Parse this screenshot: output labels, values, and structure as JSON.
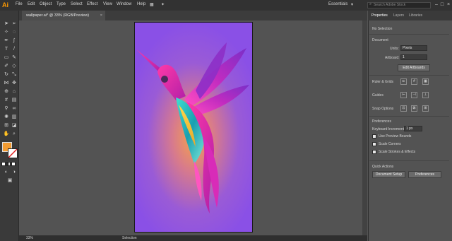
{
  "app": {
    "logo": "Ai"
  },
  "menu": [
    "File",
    "Edit",
    "Object",
    "Type",
    "Select",
    "Effect",
    "View",
    "Window",
    "Help"
  ],
  "workspace": {
    "label": "Essentials",
    "search_placeholder": "Search Adobe Stock"
  },
  "document": {
    "tab_label": "wallpaper.ai* @ 33% (RGB/Preview)",
    "close": "×"
  },
  "status": {
    "zoom": "33%",
    "tool": "Selection"
  },
  "panel": {
    "tabs": [
      "Properties",
      "Layers",
      "Libraries"
    ],
    "selection": "No Selection",
    "document_heading": "Document",
    "units_label": "Units:",
    "units_value": "Pixels",
    "artboard_label": "Artboard:",
    "artboard_value": "1",
    "edit_artboards": "Edit Artboards",
    "rulers_heading": "Ruler & Grids",
    "guides_heading": "Guides",
    "snap_heading": "Snap Options",
    "preferences_heading": "Preferences",
    "keyboard_increment_label": "Keyboard Increment:",
    "keyboard_increment_value": "1 px",
    "options": [
      "Use Preview Bounds",
      "Scale Corners",
      "Scale Strokes & Effects"
    ],
    "quick_actions_heading": "Quick Actions",
    "document_setup": "Document Setup",
    "preferences_button": "Preferences"
  },
  "colors": {
    "fill": "#f39c32",
    "artboard_purple": "#8a50e6",
    "accent": "#ff9a00"
  },
  "icons": [
    "selection-tool-icon",
    "direct-selection-tool-icon",
    "pen-tool-icon",
    "type-tool-icon",
    "rectangle-tool-icon",
    "brush-tool-icon",
    "rotate-tool-icon",
    "eyedropper-tool-icon",
    "hand-tool-icon",
    "zoom-tool-icon"
  ]
}
